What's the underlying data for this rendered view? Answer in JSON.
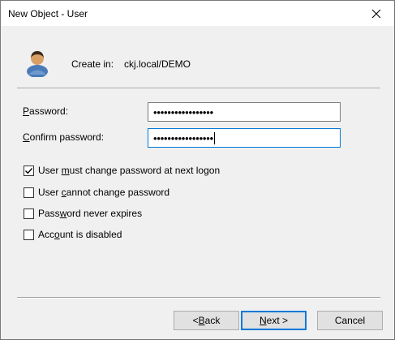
{
  "window": {
    "title": "New Object - User"
  },
  "header": {
    "create_in_label": "Create in:",
    "create_in_value": "ckj.local/DEMO"
  },
  "fields": {
    "password": {
      "label_hot": "P",
      "label_rest": "assword:",
      "value": "•••••••••••••••••"
    },
    "confirm": {
      "label_hot": "C",
      "label_rest": "onfirm password:",
      "value": "•••••••••••••••••"
    }
  },
  "options": [
    {
      "pre": "User ",
      "hot": "m",
      "post": "ust change password at next logon",
      "checked": true
    },
    {
      "pre": "User ",
      "hot": "c",
      "post": "annot change password",
      "checked": false
    },
    {
      "pre": "Pass",
      "hot": "w",
      "post": "ord never expires",
      "checked": false
    },
    {
      "pre": "Acc",
      "hot": "o",
      "post": "unt is disabled",
      "checked": false
    }
  ],
  "buttons": {
    "back": {
      "pre": "< ",
      "hot": "B",
      "post": "ack"
    },
    "next": {
      "pre": "",
      "hot": "N",
      "post": "ext >"
    },
    "cancel": "Cancel"
  },
  "icons": {
    "close": "close-icon",
    "user": "user-icon",
    "check": "check-icon"
  },
  "colors": {
    "focus": "#0078d7",
    "dialog_bg": "#f0f0f0"
  }
}
